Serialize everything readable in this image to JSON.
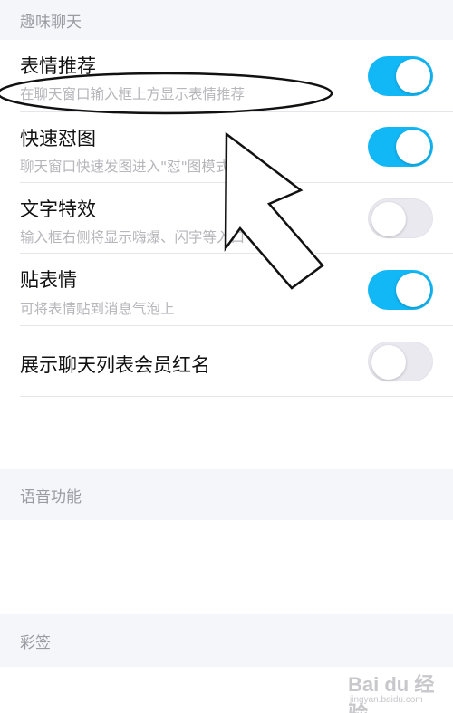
{
  "sections": {
    "fun_chat": "趣味聊天",
    "voice": "语音功能",
    "caiqian": "彩签"
  },
  "settings": [
    {
      "title": "表情推荐",
      "subtitle": "在聊天窗口输入框上方显示表情推荐",
      "enabled": true
    },
    {
      "title": "快速怼图",
      "subtitle": "聊天窗口快速发图进入\"怼\"图模式",
      "enabled": true
    },
    {
      "title": "文字特效",
      "subtitle": "输入框右侧将显示嗨爆、闪字等入口",
      "enabled": false
    },
    {
      "title": "贴表情",
      "subtitle": "可将表情贴到消息气泡上",
      "enabled": true
    },
    {
      "title": "展示聊天列表会员红名",
      "enabled": false
    }
  ],
  "colors": {
    "toggle_on": "#12b7f5",
    "toggle_off": "#e9e9ef"
  },
  "watermark": {
    "main": "Bai du 经验",
    "sub": "jingyan.baidu.com"
  }
}
